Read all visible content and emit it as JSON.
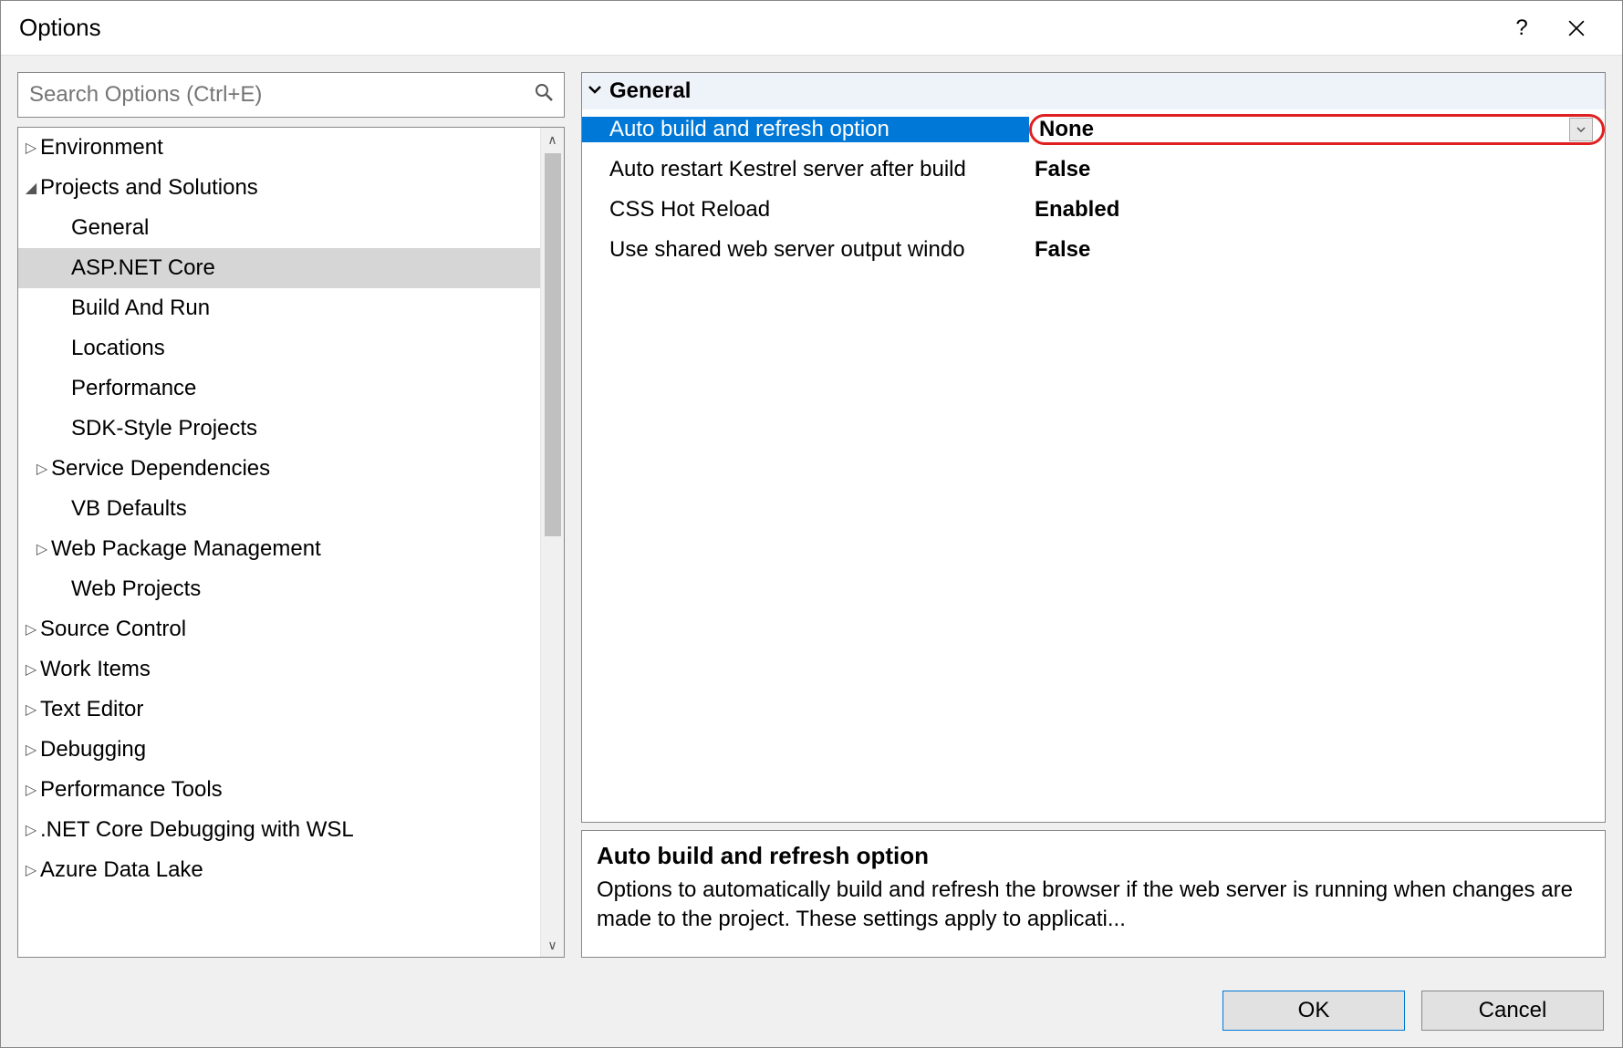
{
  "window": {
    "title": "Options"
  },
  "search": {
    "placeholder": "Search Options (Ctrl+E)"
  },
  "tree": {
    "items": [
      {
        "label": "Environment",
        "level": 0,
        "exp": "▷",
        "selected": false
      },
      {
        "label": "Projects and Solutions",
        "level": 0,
        "exp": "◢",
        "selected": false
      },
      {
        "label": "General",
        "level": 1,
        "exp": "",
        "selected": false
      },
      {
        "label": "ASP.NET Core",
        "level": 1,
        "exp": "",
        "selected": true
      },
      {
        "label": "Build And Run",
        "level": 1,
        "exp": "",
        "selected": false
      },
      {
        "label": "Locations",
        "level": 1,
        "exp": "",
        "selected": false
      },
      {
        "label": "Performance",
        "level": 1,
        "exp": "",
        "selected": false
      },
      {
        "label": "SDK-Style Projects",
        "level": 1,
        "exp": "",
        "selected": false
      },
      {
        "label": "Service Dependencies",
        "level": 1,
        "exp": "▷",
        "selected": false
      },
      {
        "label": "VB Defaults",
        "level": 1,
        "exp": "",
        "selected": false
      },
      {
        "label": "Web Package Management",
        "level": 1,
        "exp": "▷",
        "selected": false
      },
      {
        "label": "Web Projects",
        "level": 1,
        "exp": "",
        "selected": false
      },
      {
        "label": "Source Control",
        "level": 0,
        "exp": "▷",
        "selected": false
      },
      {
        "label": "Work Items",
        "level": 0,
        "exp": "▷",
        "selected": false
      },
      {
        "label": "Text Editor",
        "level": 0,
        "exp": "▷",
        "selected": false
      },
      {
        "label": "Debugging",
        "level": 0,
        "exp": "▷",
        "selected": false
      },
      {
        "label": "Performance Tools",
        "level": 0,
        "exp": "▷",
        "selected": false
      },
      {
        "label": ".NET Core Debugging with WSL",
        "level": 0,
        "exp": "▷",
        "selected": false
      },
      {
        "label": "Azure Data Lake",
        "level": 0,
        "exp": "▷",
        "selected": false
      }
    ]
  },
  "grid": {
    "section": "General",
    "rows": [
      {
        "label": "Auto build and refresh option",
        "value": "None",
        "selected": true,
        "dropdown": true
      },
      {
        "label": "Auto restart Kestrel server after build",
        "value": "False",
        "selected": false,
        "dropdown": false
      },
      {
        "label": "CSS Hot Reload",
        "value": "Enabled",
        "selected": false,
        "dropdown": false
      },
      {
        "label": "Use shared web server output windo",
        "value": "False",
        "selected": false,
        "dropdown": false
      }
    ]
  },
  "description": {
    "title": "Auto build and refresh option",
    "body": "Options to automatically build and refresh the browser if the web server is running when changes are made to the project. These settings apply to applicati..."
  },
  "buttons": {
    "ok": "OK",
    "cancel": "Cancel"
  }
}
